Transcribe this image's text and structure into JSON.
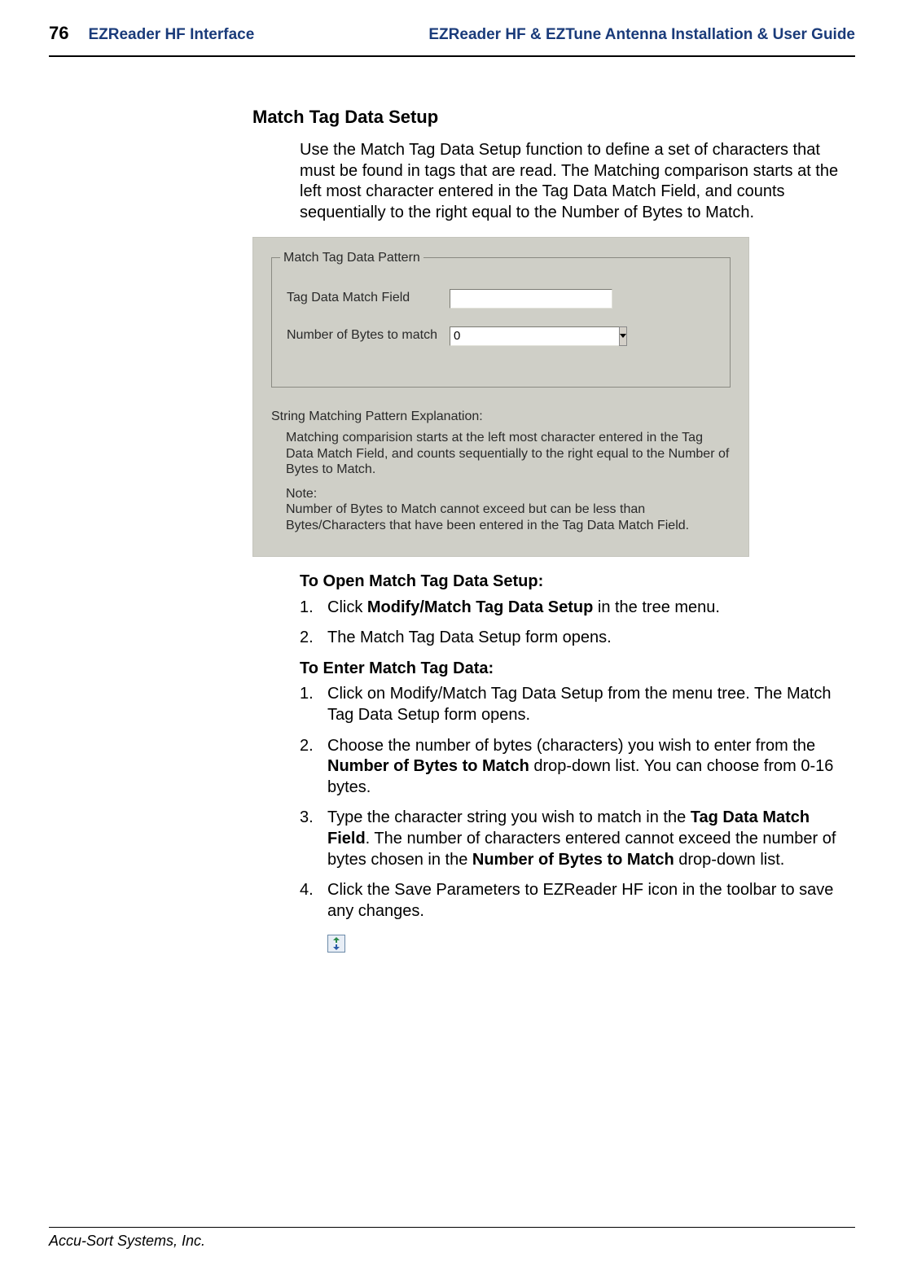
{
  "header": {
    "page_number": "76",
    "left_title": "EZReader HF Interface",
    "right_title": "EZReader HF & EZTune Antenna Installation & User Guide"
  },
  "section": {
    "title": "Match Tag Data Setup",
    "intro": "Use the Match Tag Data Setup function to define a set of characters that must be found in tags that are read. The Matching comparison starts at the left most character entered in the Tag Data Match Field, and counts sequentially to the right equal to the Number of Bytes to Match."
  },
  "screenshot": {
    "group_legend": "Match Tag Data Pattern",
    "field1_label": "Tag Data Match Field",
    "field1_value": "",
    "field2_label": "Number of Bytes to match",
    "field2_value": "0",
    "explain_title": "String Matching Pattern Explanation:",
    "explain_p1": "Matching comparision starts at the left most character entered in the Tag Data Match Field, and counts sequentially to the right equal  to the Number of Bytes to Match.",
    "explain_note_label": "Note:",
    "explain_p2": "Number of Bytes to Match cannot exceed but can be less than Bytes/Characters that have been entered in the Tag Data Match Field."
  },
  "proc1": {
    "heading": "To Open Match Tag Data Setup:",
    "steps": [
      {
        "num": "1.",
        "pre": "Click ",
        "bold": "Modify/Match Tag Data Setup",
        "post": " in the tree menu."
      },
      {
        "num": "2.",
        "pre": "The Match Tag Data Setup form opens.",
        "bold": "",
        "post": ""
      }
    ]
  },
  "proc2": {
    "heading": "To Enter Match Tag Data:",
    "step1": {
      "num": "1.",
      "text": "Click on Modify/Match Tag Data Setup from the menu tree. The Match Tag Data Setup form opens."
    },
    "step2": {
      "num": "2.",
      "pre": "Choose the number of bytes (characters) you wish to enter from the ",
      "bold": "Number of Bytes to Match",
      "post": " drop-down list. You can choose from 0-16 bytes."
    },
    "step3": {
      "num": "3.",
      "pre": "Type the character string you wish to match in the ",
      "bold1": "Tag Data Match Field",
      "mid": ". The number of characters entered cannot exceed the number of bytes chosen in the ",
      "bold2": "Number of Bytes to Match",
      "post": " drop-down list."
    },
    "step4": {
      "num": "4.",
      "text": "Click the Save Parameters to EZReader HF icon in the toolbar to save any changes."
    }
  },
  "footer": {
    "company": "Accu-Sort Systems, Inc."
  }
}
